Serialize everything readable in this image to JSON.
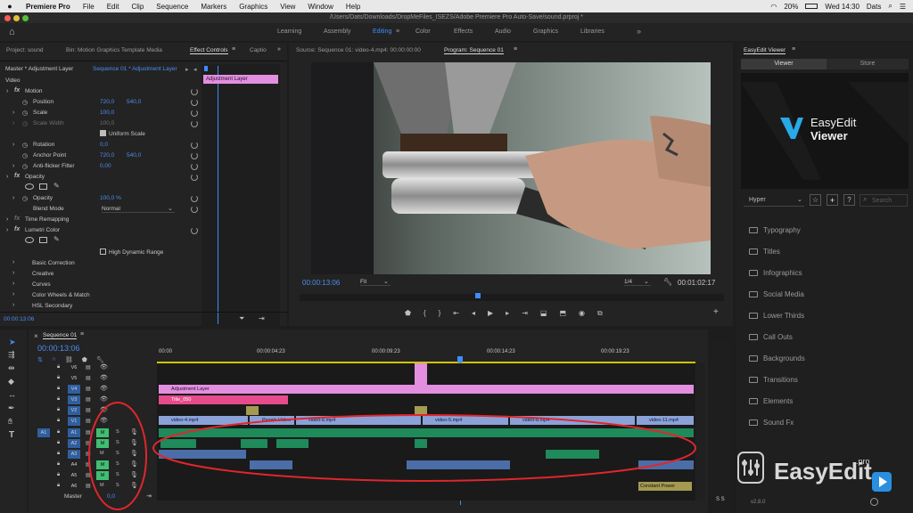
{
  "menubar": {
    "app": "Premiere Pro",
    "items": [
      "File",
      "Edit",
      "Clip",
      "Sequence",
      "Markers",
      "Graphics",
      "View",
      "Window",
      "Help"
    ],
    "battery": "20%",
    "clock": "Wed 14:30",
    "user": "Dats"
  },
  "title_path": "/Users/Dats/Downloads/DropMeFiles_ISEZS/Adobe Premiere Pro Auto-Save/sound.prproj *",
  "workspaces": [
    "Learning",
    "Assembly",
    "Editing",
    "Color",
    "Effects",
    "Audio",
    "Graphics",
    "Libraries"
  ],
  "source_panel": {
    "tabs": [
      "Project: sound",
      "Bin: Motion Graphics Template Media",
      "Effect Controls",
      "Captio"
    ],
    "master_label": "Master * Adjustment Layer",
    "sequence_label": "Sequence 01 * Adjustment Layer",
    "section_video": "Video",
    "clip_label": "Adjustment Layer",
    "motion": "Motion",
    "position": "Position",
    "position_x": "720,0",
    "position_y": "540,0",
    "scale": "Scale",
    "scale_val": "100,0",
    "scale_width": "Scale Width",
    "scale_width_val": "100,0",
    "uniform_scale": "Uniform Scale",
    "rotation": "Rotation",
    "rotation_val": "0,0",
    "anchor": "Anchor Point",
    "anchor_x": "720,0",
    "anchor_y": "540,0",
    "antiflicker": "Anti-flicker Filter",
    "antiflicker_val": "0,00",
    "opacity": "Opacity",
    "opacity_sub": "Opacity",
    "opacity_val": "100,0 %",
    "blend_mode": "Blend Mode",
    "blend_val": "Normal",
    "time_remap": "Time Remapping",
    "lumetri": "Lumetri Color",
    "hdr": "High Dynamic Range",
    "lumetri_items": [
      "Basic Correction",
      "Creative",
      "Curves",
      "Color Wheels & Match",
      "HSL Secondary"
    ],
    "timecode": "00:00:13:06"
  },
  "program_panel": {
    "source_tab": "Source: Sequence 01: video-4.mp4: 00:00:00:00",
    "program_tab": "Program: Sequence 01",
    "timecode": "00:00:13:06",
    "fit": "Fit",
    "resolution": "1/4",
    "duration": "00:01:02:17"
  },
  "easyedit": {
    "panel_title": "EasyEdit Viewer",
    "tab_viewer": "Viewer",
    "tab_store": "Store",
    "logo_line1": "EasyEdit",
    "logo_line2": "Viewer",
    "dropdown": "Hyper",
    "search_placeholder": "Search",
    "categories": [
      "Typography",
      "Titles",
      "Infographics",
      "Social Media",
      "Lower Thirds",
      "Call Outs",
      "Backgrounds",
      "Transitions",
      "Elements",
      "Sound Fx"
    ],
    "version": "v2.8.0",
    "watermark": "EasyEdit",
    "watermark_suffix": ".pro"
  },
  "timeline": {
    "tab": "Sequence 01",
    "timecode": "00:00:13:06",
    "ruler": [
      "00:00",
      "00:00:04:23",
      "00:00:09:23",
      "00:00:14:23",
      "00:00:19:23"
    ],
    "video_tracks": [
      "V6",
      "V5",
      "V4",
      "V3",
      "V2",
      "V1"
    ],
    "audio_tracks": [
      "A1",
      "A2",
      "A3",
      "A4",
      "A5",
      "A6"
    ],
    "source_patch": "A1",
    "master_label": "Master",
    "master_val": "0,0",
    "m_label": "M",
    "s_label": "S",
    "meter_label": "S S",
    "clips": {
      "adjustment": "Adjustment Layer",
      "title": "Title_050",
      "v1_1": "video-4.mp4",
      "v1_2": "Pexels Video",
      "v1_3": "video-8.mp4",
      "v1_4": "video-5.mp4",
      "v1_5": "video-8.mp4",
      "v1_6": "video-11.mp4",
      "a5": "Constant Power"
    }
  },
  "colors": {
    "accent": "#3f8cff",
    "video_clip": "#8aa2d8",
    "adjustment_clip": "#e28fe0",
    "title_clip": "#e64b8c",
    "audio_clip": "#1f8a5a",
    "annotation": "#e0262c"
  }
}
